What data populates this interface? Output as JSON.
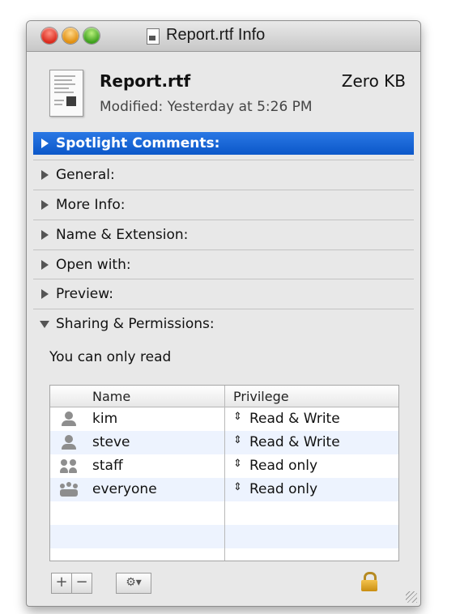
{
  "window": {
    "title": "Report.rtf Info"
  },
  "file": {
    "name": "Report.rtf",
    "size": "Zero KB",
    "modified": "Modified: Yesterday at 5:26 PM",
    "icon": "rtf-document-icon"
  },
  "sections": [
    {
      "label": "Spotlight Comments:",
      "state": "selected"
    },
    {
      "label": "General:",
      "state": "collapsed"
    },
    {
      "label": "More Info:",
      "state": "collapsed"
    },
    {
      "label": "Name & Extension:",
      "state": "collapsed"
    },
    {
      "label": "Open with:",
      "state": "collapsed"
    },
    {
      "label": "Preview:",
      "state": "collapsed"
    },
    {
      "label": "Sharing & Permissions:",
      "state": "expanded"
    }
  ],
  "permissions": {
    "note": "You can only read",
    "headers": {
      "name": "Name",
      "privilege": "Privilege"
    },
    "rows": [
      {
        "name": "kim",
        "privilege": "Read & Write",
        "icon": "user-icon"
      },
      {
        "name": "steve",
        "privilege": "Read & Write",
        "icon": "user-icon"
      },
      {
        "name": "staff",
        "privilege": "Read only",
        "icon": "group-icon"
      },
      {
        "name": "everyone",
        "privilege": "Read only",
        "icon": "everyone-icon"
      }
    ],
    "buttons": {
      "add": "+",
      "remove": "−",
      "action": "⚙▾"
    }
  },
  "colors": {
    "selection": "#0b57c9",
    "alt_row": "#edf3fe"
  }
}
